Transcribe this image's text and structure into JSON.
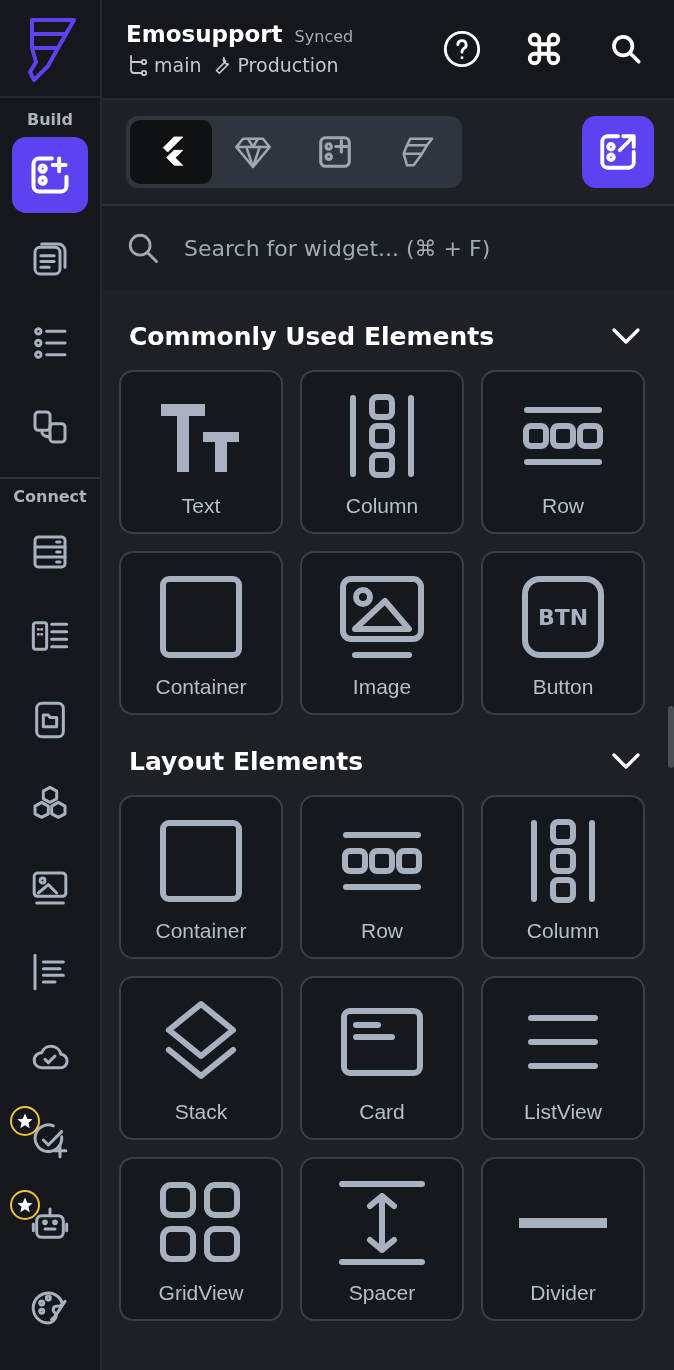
{
  "header": {
    "project": "Emosupport",
    "sync_status": "Synced",
    "branch": "main",
    "environment": "Production"
  },
  "rail": [
    {
      "label": "Build",
      "items": [
        {
          "kind": "widgets",
          "selected": true
        },
        {
          "kind": "pages",
          "selected": false
        },
        {
          "kind": "tree",
          "selected": false
        },
        {
          "kind": "swap",
          "selected": false
        }
      ]
    },
    {
      "label": "Connect",
      "items": [
        {
          "kind": "database",
          "selected": false
        },
        {
          "kind": "datalist",
          "selected": false
        },
        {
          "kind": "folder",
          "selected": false
        },
        {
          "kind": "hexagons",
          "selected": false
        },
        {
          "kind": "media",
          "selected": false
        },
        {
          "kind": "text-align",
          "selected": false
        },
        {
          "kind": "cloud",
          "selected": false
        },
        {
          "kind": "check-add",
          "selected": false,
          "starred": true
        },
        {
          "kind": "robot",
          "selected": false,
          "starred": true
        },
        {
          "kind": "palette",
          "selected": false
        }
      ]
    }
  ],
  "tabs": [
    {
      "kind": "flutter",
      "selected": true
    },
    {
      "kind": "gem",
      "selected": false
    },
    {
      "kind": "widgets",
      "selected": false
    },
    {
      "kind": "logo",
      "selected": false
    }
  ],
  "search": {
    "placeholder": "Search for widget... (⌘ + F)"
  },
  "sections": [
    {
      "title": "Commonly Used Elements",
      "expanded": true,
      "items": [
        {
          "label": "Text",
          "kind": "text"
        },
        {
          "label": "Column",
          "kind": "column"
        },
        {
          "label": "Row",
          "kind": "row"
        },
        {
          "label": "Container",
          "kind": "container"
        },
        {
          "label": "Image",
          "kind": "image"
        },
        {
          "label": "Button",
          "kind": "button",
          "icon_text": "BTN"
        }
      ]
    },
    {
      "title": "Layout Elements",
      "expanded": true,
      "items": [
        {
          "label": "Container",
          "kind": "container"
        },
        {
          "label": "Row",
          "kind": "row"
        },
        {
          "label": "Column",
          "kind": "column"
        },
        {
          "label": "Stack",
          "kind": "stack"
        },
        {
          "label": "Card",
          "kind": "card"
        },
        {
          "label": "ListView",
          "kind": "listview"
        },
        {
          "label": "GridView",
          "kind": "gridview"
        },
        {
          "label": "Spacer",
          "kind": "spacer"
        },
        {
          "label": "Divider",
          "kind": "divider"
        }
      ]
    }
  ]
}
